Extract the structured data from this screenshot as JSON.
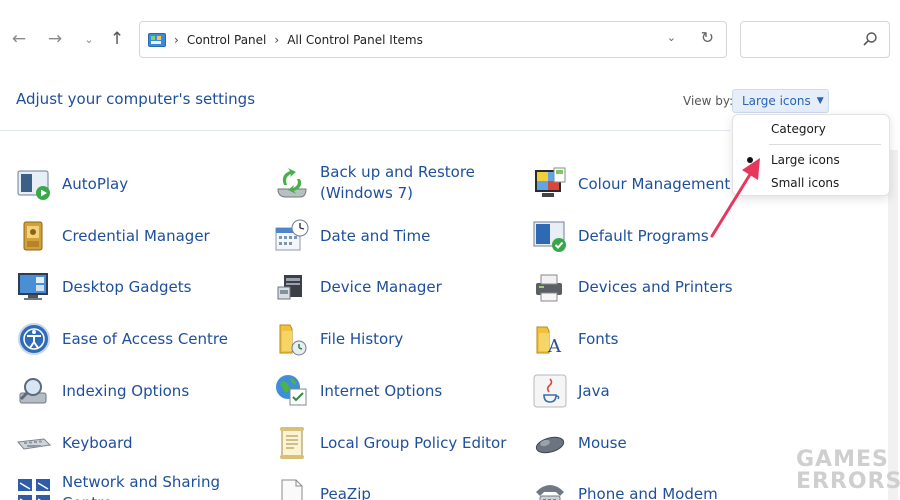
{
  "address_bar": {
    "crumbs": [
      "Control Panel",
      "All Control Panel Items"
    ]
  },
  "header": {
    "title": "Adjust your computer's settings",
    "view_by_label": "View by:",
    "view_by_value": "Large icons"
  },
  "view_menu": {
    "options": [
      "Category",
      "Large icons",
      "Small icons"
    ],
    "selected": "Large icons"
  },
  "items": [
    [
      "AutoPlay",
      "Back up and Restore\n(Windows 7)",
      "Colour Management"
    ],
    [
      "Credential Manager",
      "Date and Time",
      "Default Programs"
    ],
    [
      "Desktop Gadgets",
      "Device Manager",
      "Devices and Printers"
    ],
    [
      "Ease of Access Centre",
      "File History",
      "Fonts"
    ],
    [
      "Indexing Options",
      "Internet Options",
      "Java"
    ],
    [
      "Keyboard",
      "Local Group Policy Editor",
      "Mouse"
    ],
    [
      "Network and Sharing\nCentre",
      "PeaZip",
      "Phone and Modem"
    ]
  ],
  "colors": {
    "link_blue": "#1e4f9c",
    "annotation": "#e8365d"
  },
  "watermark": {
    "line1": "GAMES",
    "line2": "ERRORS"
  }
}
